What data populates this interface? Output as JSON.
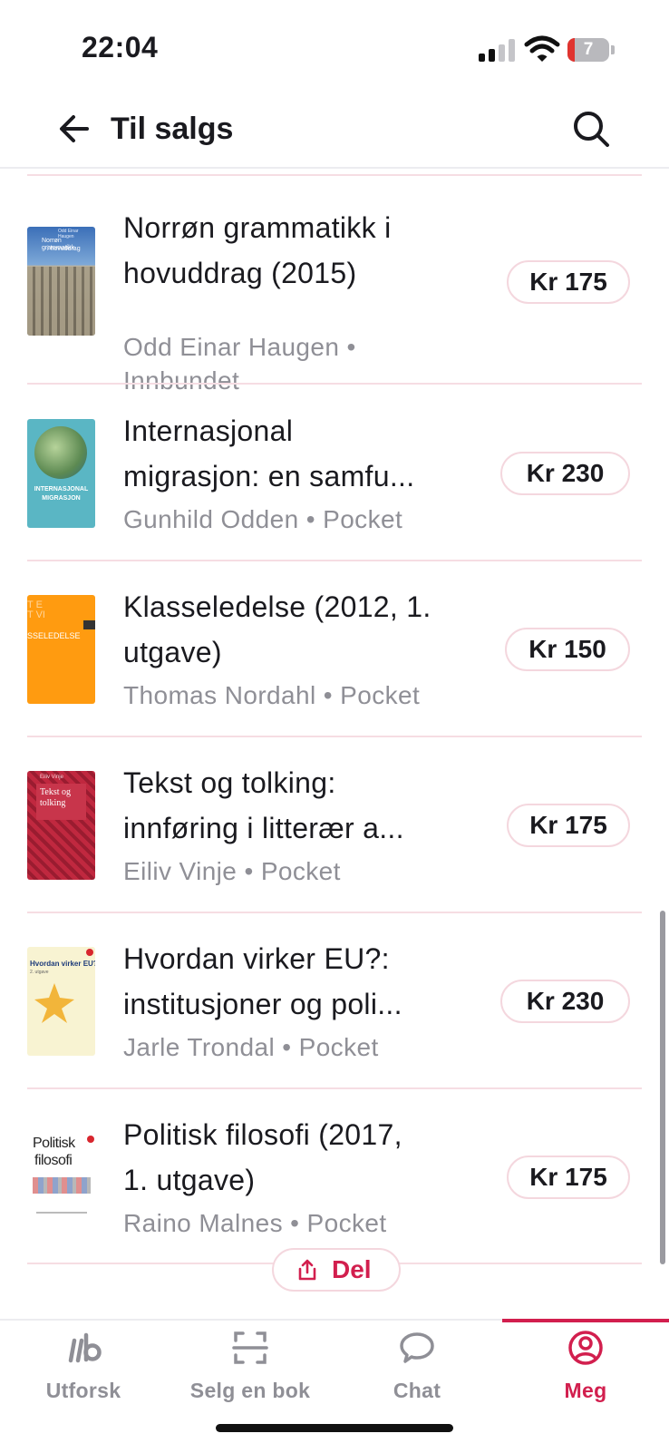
{
  "status_bar": {
    "time": "22:04",
    "battery_level": "7"
  },
  "header": {
    "title": "Til salgs",
    "back_icon": "arrow-left-icon",
    "search_icon": "search-icon"
  },
  "listings": [
    {
      "title_lines": [
        "Norrøn grammatikk i",
        "hovuddrag  (2015)"
      ],
      "meta_lines": [
        "Odd Einar Haugen  •",
        "Innbundet"
      ],
      "price": "Kr 175"
    },
    {
      "title_lines": [
        "Internasjonal",
        "migrasjon: en samfu..."
      ],
      "meta_lines": [
        "Gunhild Odden • Pocket"
      ],
      "price": "Kr 230"
    },
    {
      "title_lines": [
        "Klasseledelse (2012, 1.",
        "utgave)"
      ],
      "meta_lines": [
        "Thomas Nordahl • Pocket"
      ],
      "price": "Kr 150"
    },
    {
      "title_lines": [
        "Tekst og tolking:",
        "innføring i litterær a..."
      ],
      "meta_lines": [
        "Eiliv Vinje • Pocket"
      ],
      "price": "Kr 175"
    },
    {
      "title_lines": [
        "Hvordan virker EU?:",
        "institusjoner og poli..."
      ],
      "meta_lines": [
        "Jarle Trondal • Pocket"
      ],
      "price": "Kr 230"
    },
    {
      "title_lines": [
        "Politisk filosofi (2017,",
        "1. utgave)"
      ],
      "meta_lines": [
        "Raino Malnes • Pocket"
      ],
      "price": "Kr 175"
    }
  ],
  "covers": [
    {
      "text": [
        "Norrøn grammatikk",
        "i hovuddrag",
        "Odd Einar Haugen"
      ]
    },
    {
      "text": [
        "INTERNASJONAL",
        "MIGRASJON"
      ]
    },
    {
      "text": [
        "SSELEDELSE"
      ]
    },
    {
      "text": [
        "Eiliv Vinje",
        "Tekst og",
        "tolking"
      ]
    },
    {
      "text": [
        "Hvordan virker EU?",
        "2. utgave"
      ]
    },
    {
      "text": [
        "Politisk",
        "filosofi"
      ]
    }
  ],
  "share": {
    "label": "Del"
  },
  "bottom_nav": [
    {
      "label": "Utforsk",
      "icon": "logo-ib-icon",
      "active": false
    },
    {
      "label": "Selg en bok",
      "icon": "scan-frame-icon",
      "active": false
    },
    {
      "label": "Chat",
      "icon": "chat-bubble-icon",
      "active": false
    },
    {
      "label": "Meg",
      "icon": "profile-icon",
      "active": true
    }
  ],
  "colors": {
    "accent": "#d21f4e",
    "divider": "#f6dde3",
    "muted_text": "#8f8f96"
  }
}
